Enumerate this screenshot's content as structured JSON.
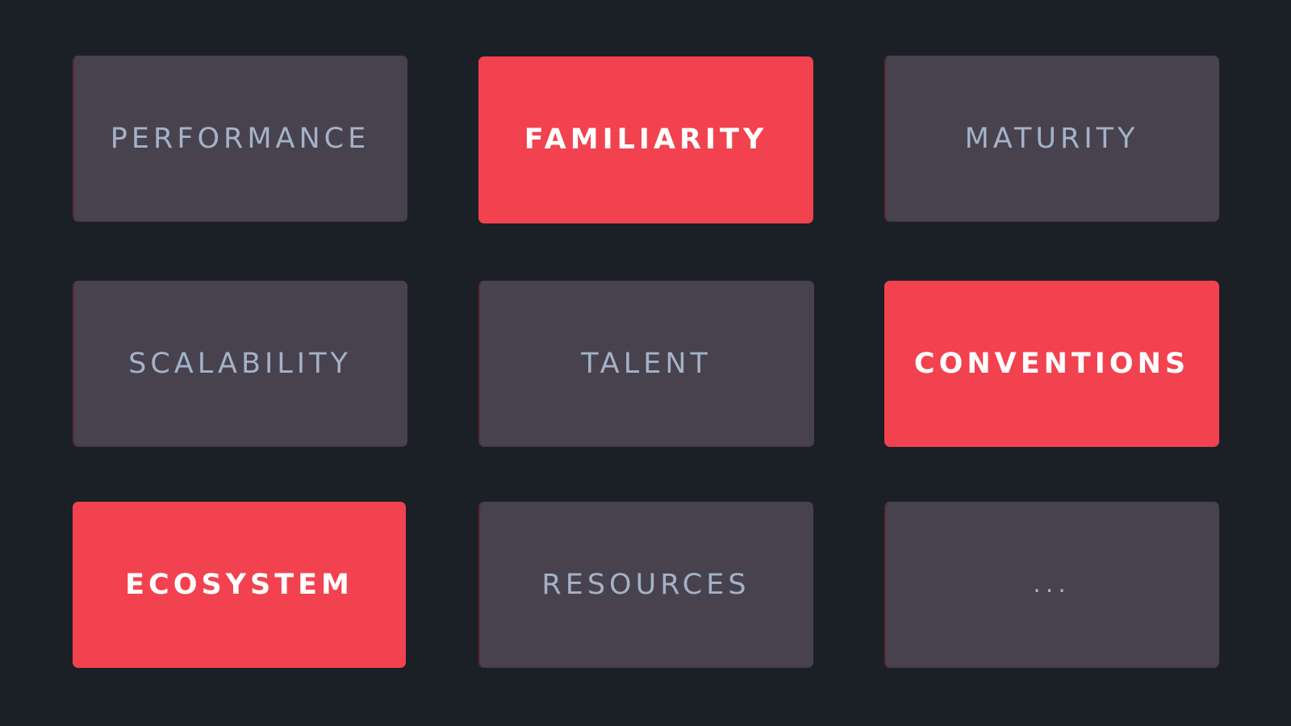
{
  "tiles": [
    {
      "label": "PERFORMANCE",
      "color": "#48424f",
      "highlighted": false
    },
    {
      "label": "FAMILIARITY",
      "color": "#f2424f",
      "highlighted": true
    },
    {
      "label": "MATURITY",
      "color": "#48424f",
      "highlighted": false
    },
    {
      "label": "SCALABILITY",
      "color": "#48424f",
      "highlighted": false
    },
    {
      "label": "TALENT",
      "color": "#48424f",
      "highlighted": false
    },
    {
      "label": "CONVENTIONS",
      "color": "#f2424f",
      "highlighted": true
    },
    {
      "label": "ECOSYSTEM",
      "color": "#f2424f",
      "highlighted": true
    },
    {
      "label": "RESOURCES",
      "color": "#48424f",
      "highlighted": false
    },
    {
      "label": "...",
      "color": "#48424f",
      "highlighted": false
    }
  ],
  "colors": {
    "background": "#1b2027",
    "tile_neutral": "#48424f",
    "tile_accent": "#f2424f",
    "label_neutral": "#a3b2c8",
    "label_accent": "#ffffff"
  }
}
